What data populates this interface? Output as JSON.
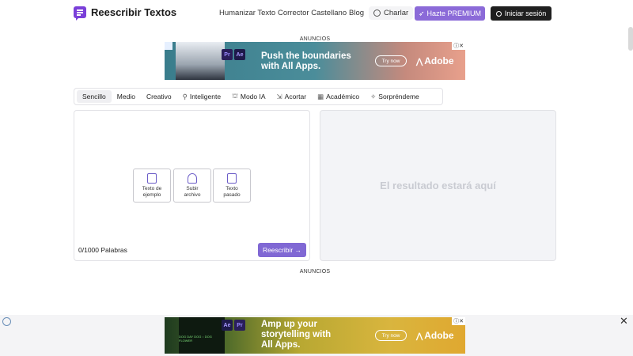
{
  "header": {
    "logo_text": "Reescribir Textos",
    "nav": [
      "Humanizar Texto",
      "Corrector Castellano",
      "Blog"
    ],
    "charlar": "Charlar",
    "premium": "Hazte PREMIUM",
    "login": "Iniciar sesión"
  },
  "ads": {
    "label_top": "ANUNCIOS",
    "label_bottom": "ANUNCIOS",
    "top": {
      "headline_line1": "Push the boundaries",
      "headline_line2": "with All Apps.",
      "cta": "Try now",
      "brand": "Adobe",
      "badge1": "Pr",
      "badge2": "Ae"
    },
    "bottom": {
      "headline_line1": "Amp up your",
      "headline_line2": "storytelling with",
      "headline_line3": "All Apps.",
      "cta": "Try now",
      "brand": "Adobe",
      "badge1": "Ae",
      "badge2": "Pr",
      "photo_text": "DOG DAY DOG :: DOG FLOWER"
    }
  },
  "modes": [
    {
      "label": "Sencillo",
      "icon": "",
      "active": true
    },
    {
      "label": "Medio",
      "icon": ""
    },
    {
      "label": "Creativo",
      "icon": ""
    },
    {
      "label": "Inteligente",
      "icon": "bulb-icon"
    },
    {
      "label": "Modo IA",
      "icon": "robot-icon"
    },
    {
      "label": "Acortar",
      "icon": "shorten-icon"
    },
    {
      "label": "Académico",
      "icon": "academic-icon"
    },
    {
      "label": "Sorpréndeme",
      "icon": "sparkle-icon"
    }
  ],
  "input": {
    "tiles": [
      {
        "line1": "Texto de",
        "line2": "ejemplo"
      },
      {
        "line1": "Subir",
        "line2": "archivo"
      },
      {
        "line1": "Texto",
        "line2": "pasado"
      }
    ],
    "word_count": "0/1000 Palabras",
    "rewrite_button": "Reescribir →"
  },
  "output": {
    "placeholder": "El resultado estará aquí"
  }
}
